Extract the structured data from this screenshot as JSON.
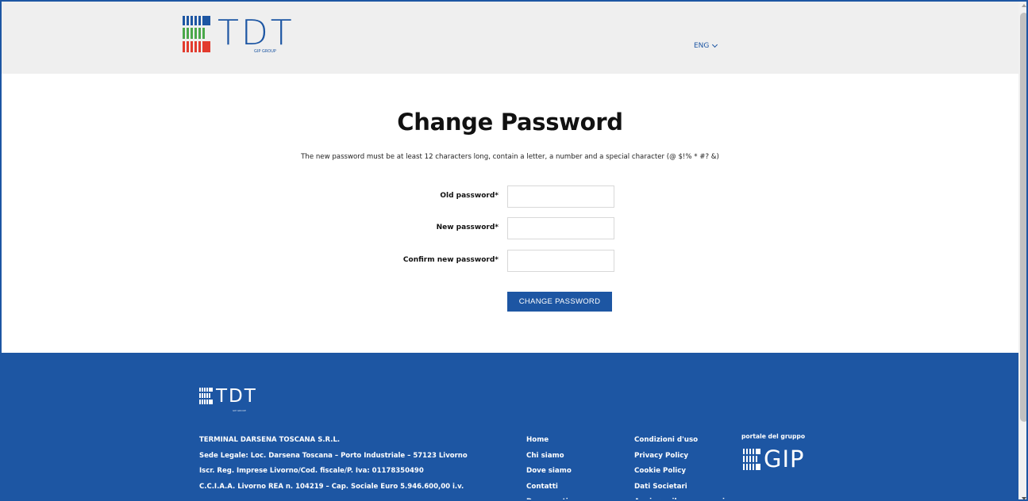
{
  "header": {
    "logo_text": "TDT",
    "logo_subtext": "GIP GROUP",
    "language": "ENG"
  },
  "main": {
    "title": "Change Password",
    "description": "The new password must be at least 12 characters long, contain a letter, a number and a special character (@ $!% * #? &)",
    "fields": {
      "old_password": {
        "label": "Old password*",
        "value": ""
      },
      "new_password": {
        "label": "New password*",
        "value": ""
      },
      "confirm_password": {
        "label": "Confirm new password*",
        "value": ""
      }
    },
    "submit_label": "CHANGE PASSWORD"
  },
  "footer": {
    "logo_text": "TDT",
    "logo_subtext": "GIP GROUP",
    "address": [
      "TERMINAL DARSENA TOSCANA S.R.L.",
      "Sede Legale: Loc. Darsena Toscana – Porto Industriale – 57123 Livorno",
      "Iscr. Reg. Imprese Livorno/Cod. fiscale/P. Iva: 01178350490",
      "C.C.I.A.A. Livorno REA n. 104219 – Cap. Sociale Euro 5.946.600,00 i.v."
    ],
    "nav_links": [
      "Home",
      "Chi siamo",
      "Dove siamo",
      "Contatti",
      "Documenti"
    ],
    "legal_links": [
      "Condizioni d'uso",
      "Privacy Policy",
      "Cookie Policy",
      "Dati Societari",
      "Aggiorna il consenso ai"
    ],
    "group_label": "portale del gruppo",
    "group_logo_text": "GIP"
  },
  "colors": {
    "brand_blue": "#1d56a3",
    "header_bg": "#efefef",
    "logo_green": "#4aa84a",
    "logo_red": "#e23b2e"
  }
}
